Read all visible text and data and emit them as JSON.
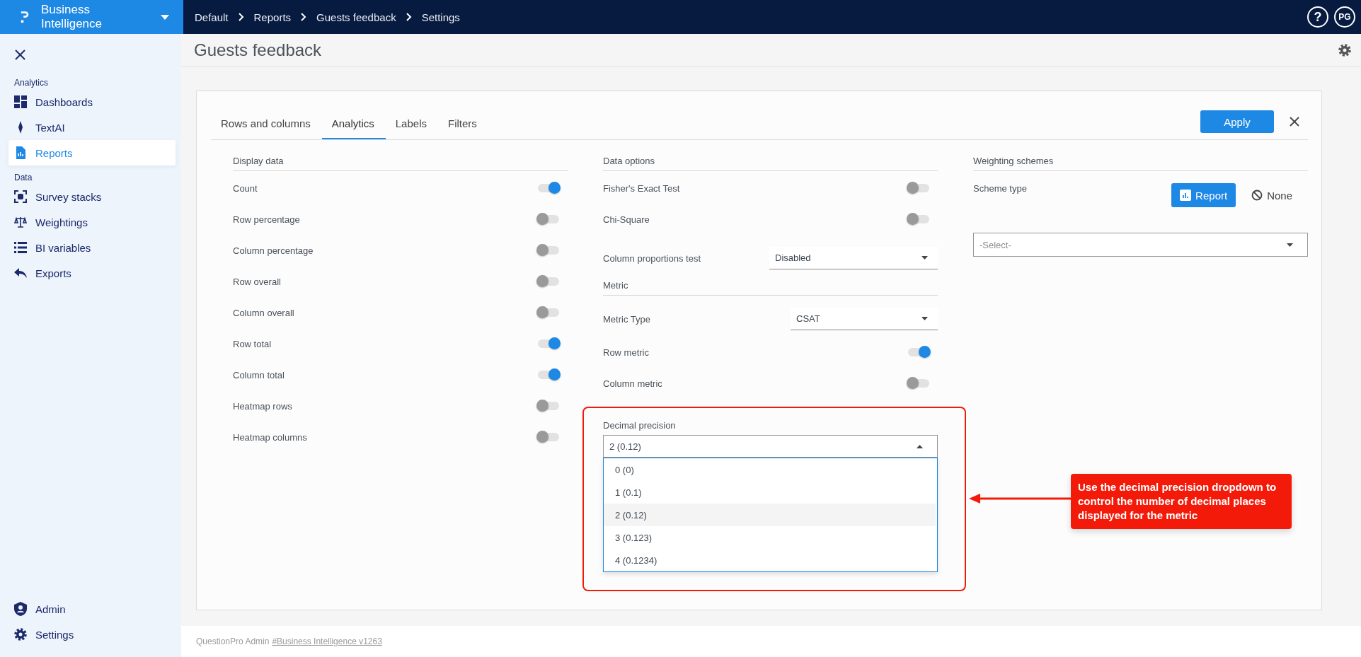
{
  "app": {
    "name": "Business Intelligence"
  },
  "breadcrumbs": [
    "Default",
    "Reports",
    "Guests feedback",
    "Settings"
  ],
  "help": {
    "label": "?"
  },
  "user": {
    "initials": "PG"
  },
  "sidebar": {
    "sections": [
      {
        "heading": "Analytics",
        "items": [
          {
            "label": "Dashboards",
            "selected": false
          },
          {
            "label": "TextAI",
            "selected": false
          },
          {
            "label": "Reports",
            "selected": true
          }
        ]
      },
      {
        "heading": "Data",
        "items": [
          {
            "label": "Survey stacks",
            "selected": false
          },
          {
            "label": "Weightings",
            "selected": false
          },
          {
            "label": "BI variables",
            "selected": false
          },
          {
            "label": "Exports",
            "selected": false
          }
        ]
      }
    ],
    "bottom_items": [
      {
        "label": "Admin",
        "selected": false
      },
      {
        "label": "Settings",
        "selected": false
      }
    ]
  },
  "page": {
    "title": "Guests feedback"
  },
  "tabs": [
    {
      "label": "Rows and columns",
      "selected": false
    },
    {
      "label": "Analytics",
      "selected": true
    },
    {
      "label": "Labels",
      "selected": false
    },
    {
      "label": "Filters",
      "selected": false
    }
  ],
  "apply_button": "Apply",
  "display_data": {
    "heading": "Display data",
    "options": [
      {
        "label": "Count",
        "on": true
      },
      {
        "label": "Row percentage",
        "on": false
      },
      {
        "label": "Column percentage",
        "on": false
      },
      {
        "label": "Row overall",
        "on": false
      },
      {
        "label": "Column overall",
        "on": false
      },
      {
        "label": "Row total",
        "on": true
      },
      {
        "label": "Column total",
        "on": true
      },
      {
        "label": "Heatmap rows",
        "on": false
      },
      {
        "label": "Heatmap columns",
        "on": false
      }
    ]
  },
  "data_options": {
    "heading": "Data options",
    "items": [
      {
        "kind": "toggle",
        "label": "Fisher's Exact Test",
        "on": false
      },
      {
        "kind": "toggle",
        "label": "Chi-Square",
        "on": false
      },
      {
        "kind": "select",
        "label": "Column proportions test",
        "value": "Disabled"
      }
    ]
  },
  "metric": {
    "heading": "Metric",
    "items": [
      {
        "kind": "select",
        "label": "Metric Type",
        "value": "CSAT"
      },
      {
        "kind": "toggle",
        "label": "Row metric",
        "on": true
      },
      {
        "kind": "toggle",
        "label": "Column metric",
        "on": false
      }
    ]
  },
  "decimal_precision": {
    "label": "Decimal precision",
    "value": "2 (0.12)",
    "expanded": true,
    "options": [
      {
        "label": "0 (0)",
        "selected": false
      },
      {
        "label": "1 (0.1)",
        "selected": false
      },
      {
        "label": "2 (0.12)",
        "selected": true
      },
      {
        "label": "3 (0.123)",
        "selected": false
      },
      {
        "label": "4 (0.1234)",
        "selected": false
      }
    ]
  },
  "weighting": {
    "heading": "Weighting schemes",
    "scheme_label": "Scheme type",
    "scheme_options": [
      {
        "label": "Report",
        "selected": true
      },
      {
        "label": "None",
        "selected": false
      }
    ],
    "select_placeholder": "-Select-"
  },
  "annotation": {
    "text": "Use the decimal precision dropdown to control the number of decimal places displayed for the metric"
  },
  "footer": {
    "text": "QuestionPro Admin",
    "link": "#Business Intelligence v1263"
  }
}
